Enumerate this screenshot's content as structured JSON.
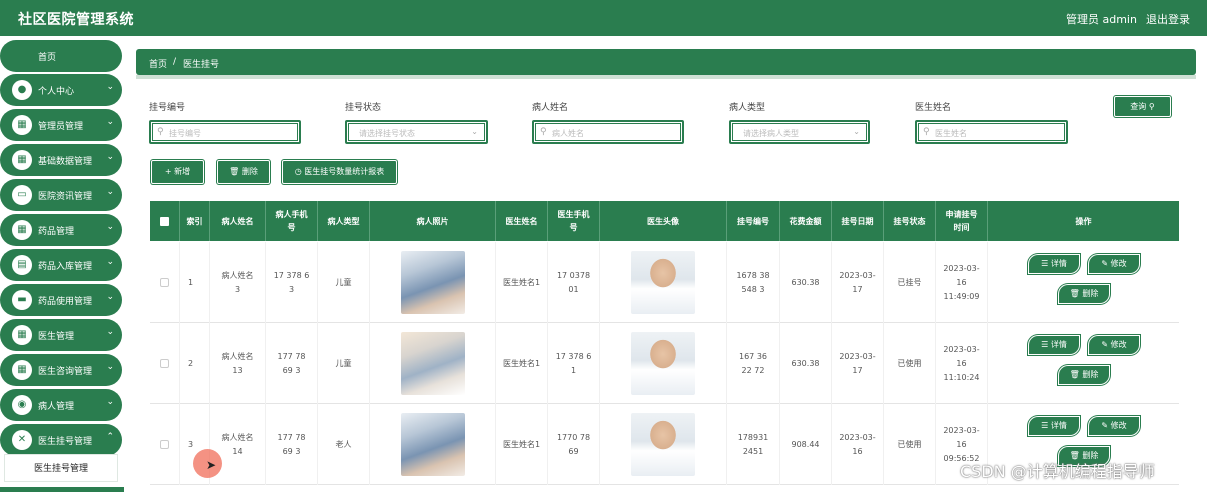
{
  "app": {
    "title": "社区医院管理系统",
    "user": "管理员 admin",
    "logout": "退出登录",
    "accent": "#2a7d4f"
  },
  "sidebar": {
    "home": "首页",
    "items": [
      {
        "label": "个人中心",
        "icon": "user-icon"
      },
      {
        "label": "管理员管理",
        "icon": "grid-icon"
      },
      {
        "label": "基础数据管理",
        "icon": "grid-icon"
      },
      {
        "label": "医院资讯管理",
        "icon": "monitor-icon"
      },
      {
        "label": "药品管理",
        "icon": "grid-icon"
      },
      {
        "label": "药品入库管理",
        "icon": "clipboard-icon"
      },
      {
        "label": "药品使用管理",
        "icon": "chat-icon"
      },
      {
        "label": "医生管理",
        "icon": "grid-icon"
      },
      {
        "label": "医生咨询管理",
        "icon": "grid-icon"
      },
      {
        "label": "病人管理",
        "icon": "location-icon"
      },
      {
        "label": "医生挂号管理",
        "icon": "tools-icon"
      }
    ],
    "active_sub": "医生挂号管理"
  },
  "breadcrumb": {
    "home": "首页",
    "sep": "/",
    "current": "医生挂号"
  },
  "filters": {
    "reg_no": {
      "label": "挂号编号",
      "placeholder": "挂号编号"
    },
    "reg_status": {
      "label": "挂号状态",
      "placeholder": "请选择挂号状态"
    },
    "patient_name": {
      "label": "病人姓名",
      "placeholder": "病人姓名"
    },
    "patient_type": {
      "label": "病人类型",
      "placeholder": "请选择病人类型"
    },
    "doctor_name": {
      "label": "医生姓名",
      "placeholder": "医生姓名"
    },
    "search": "查询"
  },
  "toolbar": {
    "add": "+ 新增",
    "delete": "删除",
    "stats": "医生挂号数量统计报表"
  },
  "table": {
    "headers": {
      "index": "索引",
      "patient_name": "病人姓名",
      "patient_phone": "病人手机号",
      "patient_type": "病人类型",
      "patient_photo": "病人照片",
      "doctor_name": "医生姓名",
      "doctor_phone": "医生手机号",
      "doctor_avatar": "医生头像",
      "reg_no": "挂号编号",
      "fee": "花费金额",
      "reg_date": "挂号日期",
      "status": "挂号状态",
      "apply_time": "申请挂号时间",
      "ops": "操作"
    },
    "rows": [
      {
        "index": "1",
        "patient_name": "病人姓名3",
        "patient_phone": "17 378 6 3",
        "patient_type": "儿童",
        "doctor_name": "医生姓名1",
        "doctor_phone": "17 0378 01",
        "reg_no": "1678 38 548 3",
        "fee": "630.38",
        "reg_date": "2023-03-17",
        "status": "已挂号",
        "apply_time": "2023-03-16 11:49:09"
      },
      {
        "index": "2",
        "patient_name": "病人姓名13",
        "patient_phone": "177 78 69 3",
        "patient_type": "儿童",
        "doctor_name": "医生姓名1",
        "doctor_phone": "17 378 6 1",
        "reg_no": "167 36 22 72",
        "fee": "630.38",
        "reg_date": "2023-03-17",
        "status": "已使用",
        "apply_time": "2023-03-16 11:10:24"
      },
      {
        "index": "3",
        "patient_name": "病人姓名14",
        "patient_phone": "177 78 69 3",
        "patient_type": "老人",
        "doctor_name": "医生姓名1",
        "doctor_phone": "1770 78 69",
        "reg_no": "178931 2451",
        "fee": "908.44",
        "reg_date": "2023-03-16",
        "status": "已使用",
        "apply_time": "2023-03-16 09:56:52"
      }
    ],
    "actions": {
      "detail": "详情",
      "edit": "修改",
      "delete": "删除"
    }
  },
  "watermark": "CSDN @计算机编程指导师"
}
